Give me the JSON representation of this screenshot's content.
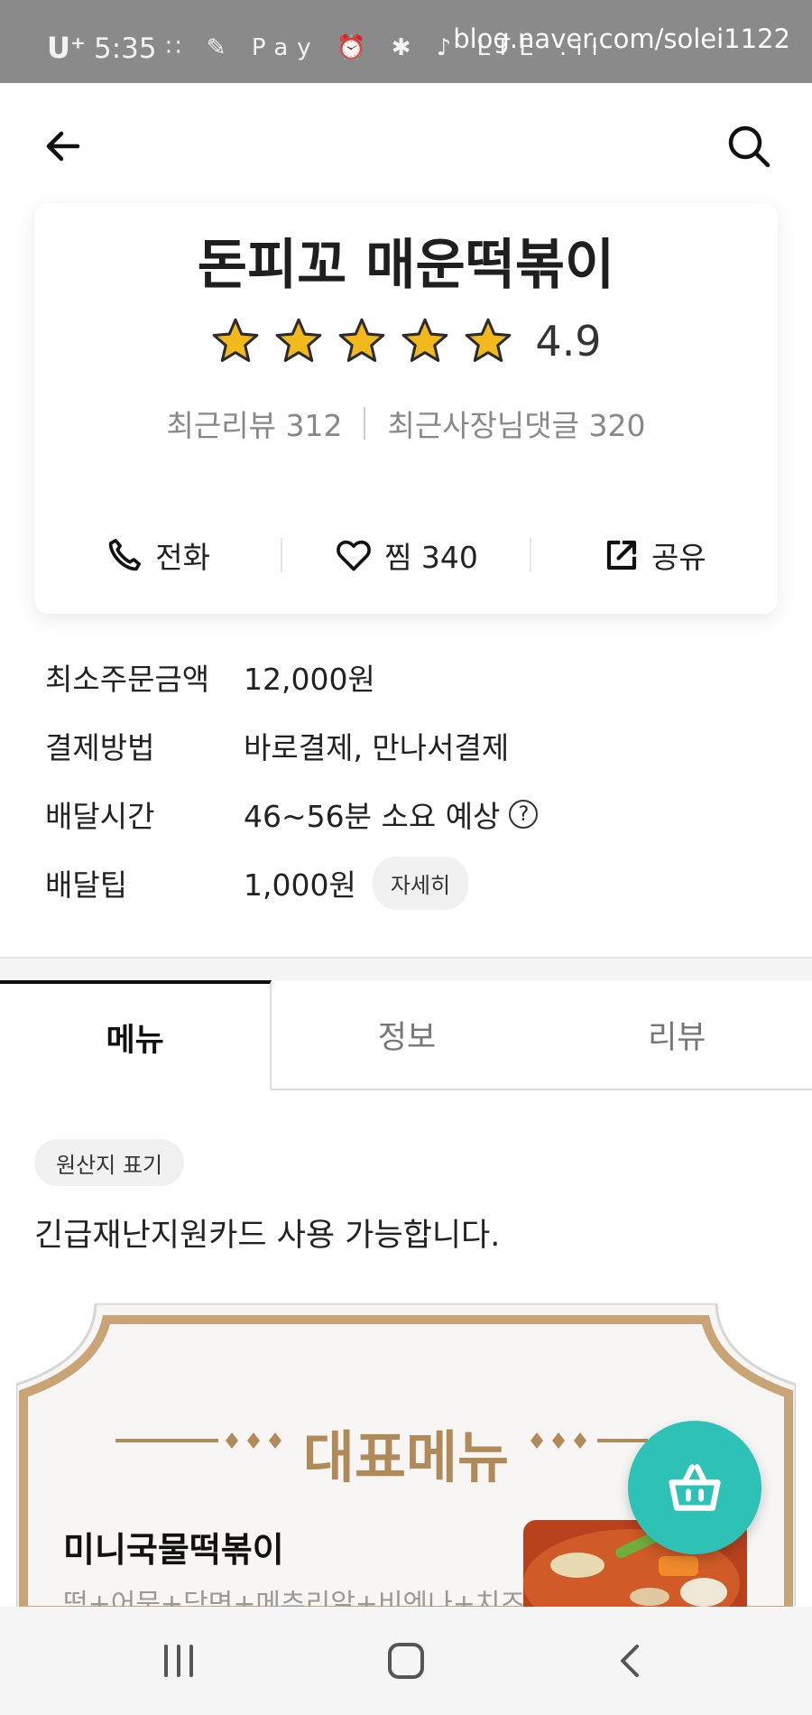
{
  "status_bar": {
    "carrier": "U⁺",
    "time": "5:35",
    "icons_text": "∷ ✎ Pay ⏰ ✱ ♪ LTE .ıl",
    "watermark": "blog.naver.com/solei1122"
  },
  "store": {
    "name": "돈피꼬 매운떡볶이",
    "rating": 4.9,
    "rating_text": "4.9",
    "stars_filled": 5,
    "recent_reviews": "최근리뷰 312",
    "recent_owner_comments": "최근사장님댓글 320",
    "actions": {
      "call": "전화",
      "favorite": "찜 340",
      "share": "공유"
    }
  },
  "info": {
    "min_order_label": "최소주문금액",
    "min_order_value": "12,000원",
    "payment_label": "결제방법",
    "payment_value": "바로결제, 만나서결제",
    "delivery_time_label": "배달시간",
    "delivery_time_value": "46~56분 소요 예상",
    "delivery_tip_label": "배달팁",
    "delivery_tip_value": "1,000원",
    "detail_chip": "자세히"
  },
  "tabs": [
    "메뉴",
    "정보",
    "리뷰"
  ],
  "origin_chip": "원산지 표기",
  "notice": "긴급재난지원카드 사용 가능합니다.",
  "menu": {
    "banner_title": "대표메뉴",
    "item_name": "미니국물떡볶이",
    "item_desc": "떡+어묵+당면+메추리알+비엔나+치즈+"
  },
  "colors": {
    "accent_teal": "#2ec1b5",
    "star_gold": "#f2b81c",
    "banner_tan": "#b08a58"
  }
}
